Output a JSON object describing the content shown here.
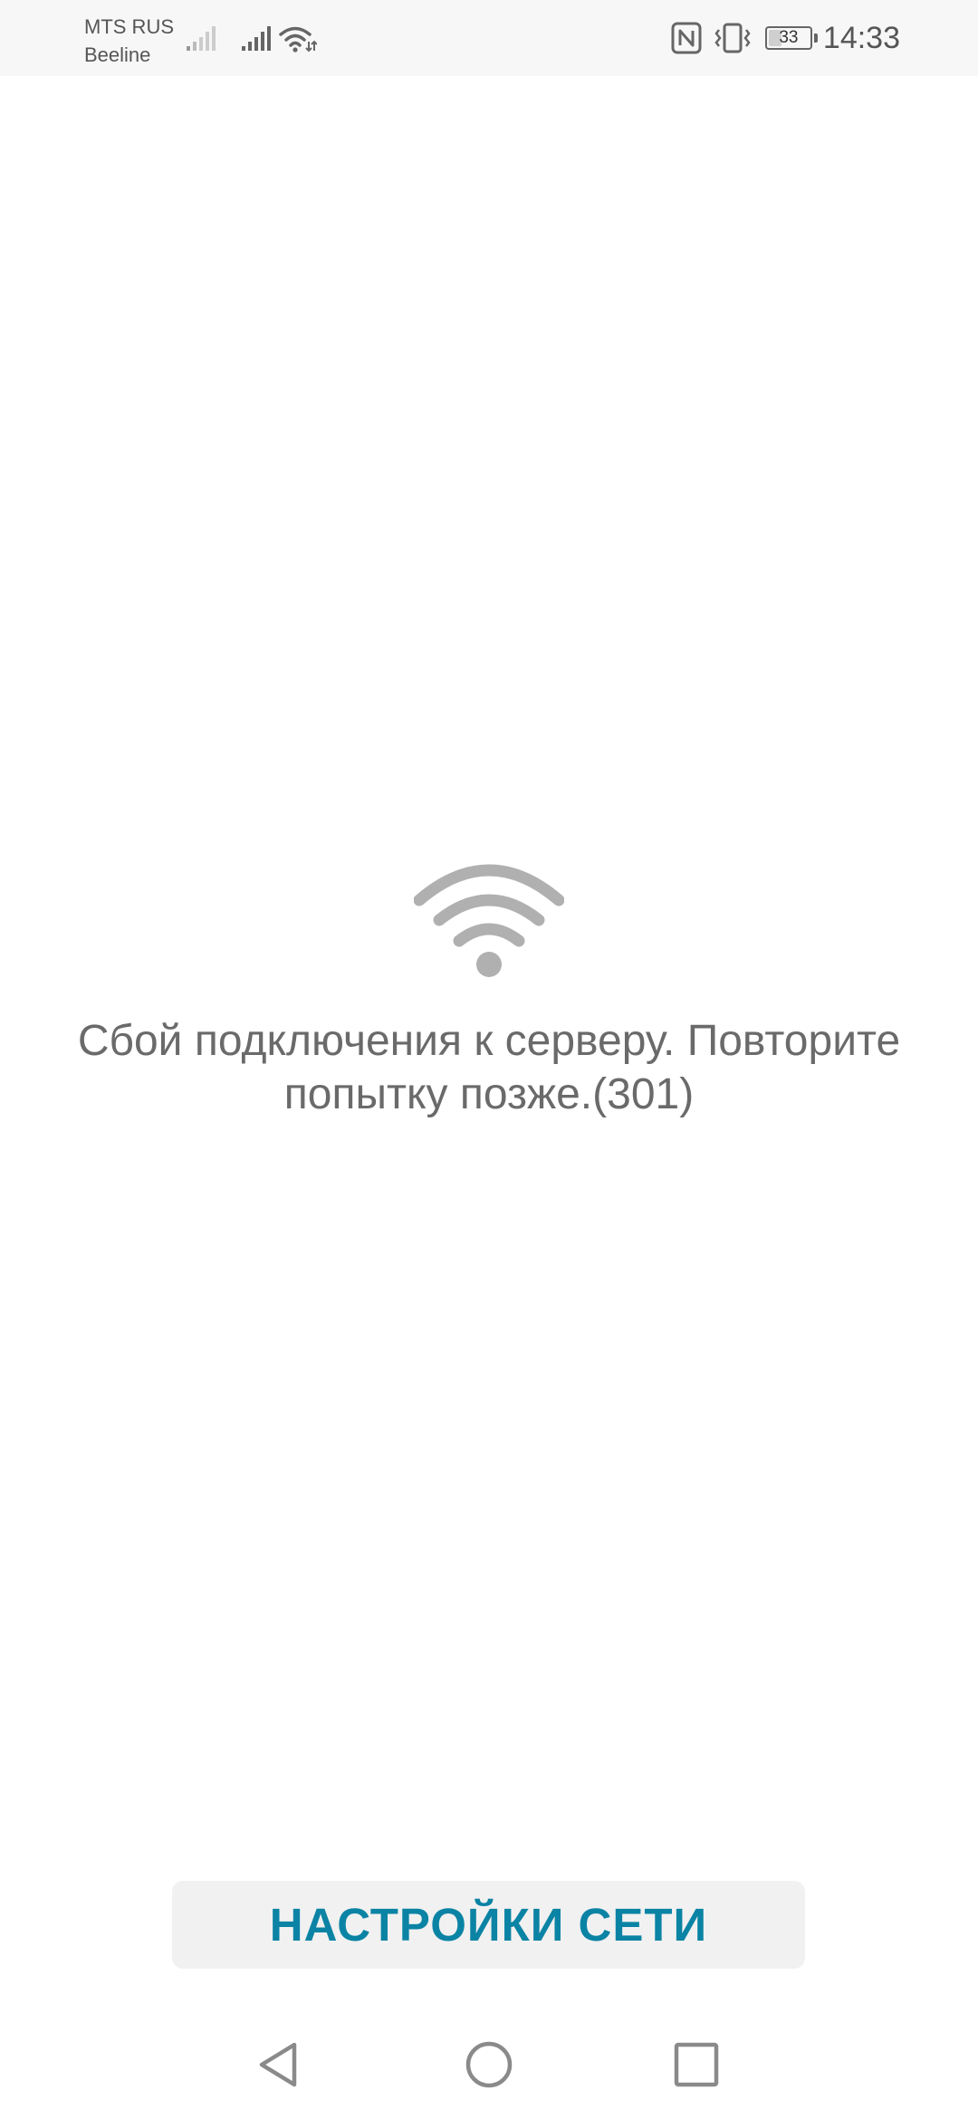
{
  "status_bar": {
    "carrier_1": "MTS RUS",
    "carrier_2": "Beeline",
    "battery_percent": "33",
    "battery_level": 0.33,
    "time": "14:33",
    "icons": [
      "signal-1-icon",
      "signal-2-icon",
      "wifi-icon",
      "nfc-icon",
      "vibrate-icon",
      "battery-icon"
    ]
  },
  "main": {
    "icon": "wifi-icon",
    "error_message": "Сбой подключения к серверу. Повторите попытку позже.(301)"
  },
  "actions": {
    "network_settings_label": "НАСТРОЙКИ СЕТИ"
  },
  "nav_bar": {
    "icons": [
      "back-icon",
      "home-icon",
      "recents-icon"
    ]
  },
  "colors": {
    "accent": "#0b83a4",
    "text": "#6a6a6a",
    "icon_gray": "#b0b0b0",
    "status_bar_bg": "#f7f7f7",
    "button_bg": "#f1f1f1"
  }
}
